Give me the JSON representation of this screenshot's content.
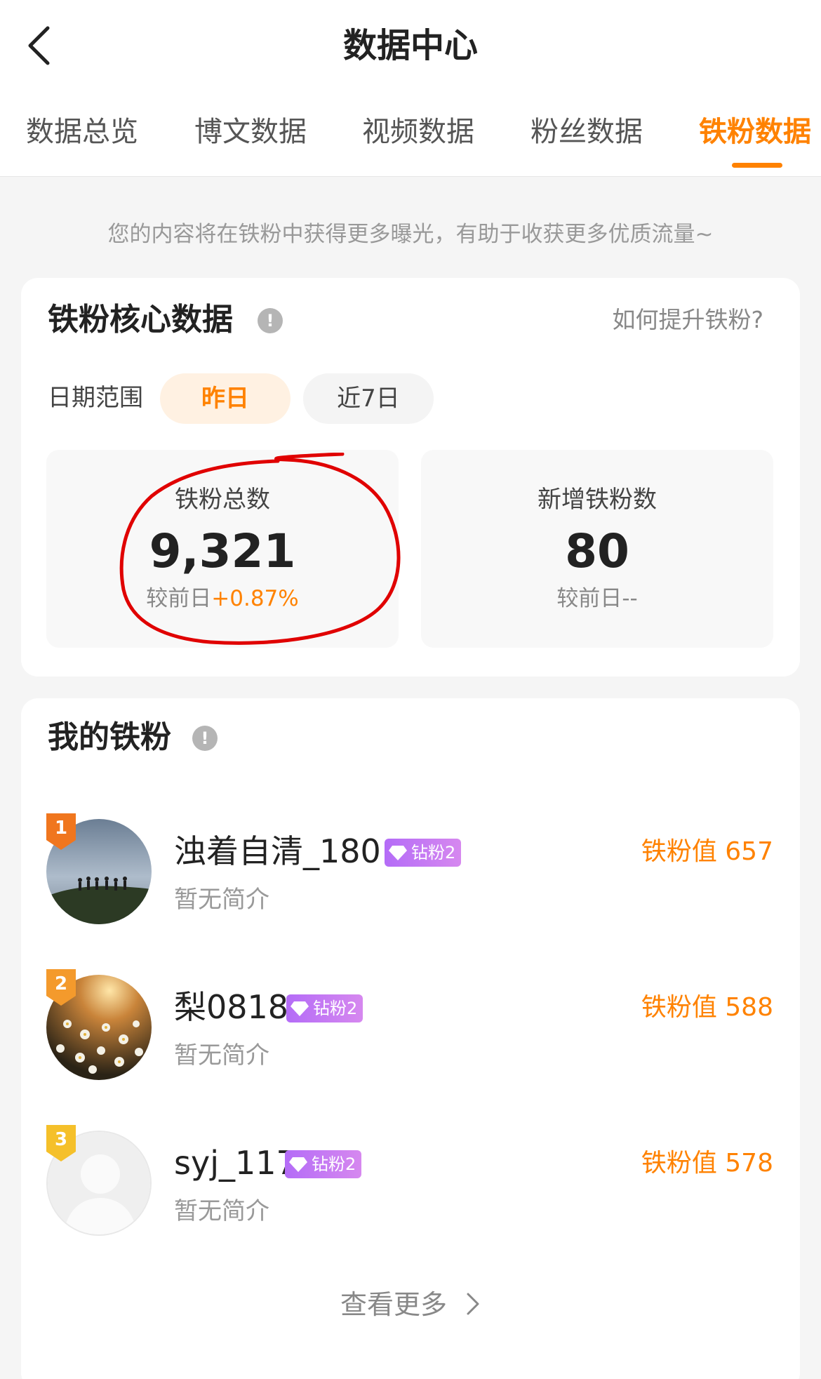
{
  "header": {
    "title": "数据中心",
    "back_icon": "chevron-left-icon"
  },
  "tabs": [
    {
      "label": "数据总览",
      "active": false
    },
    {
      "label": "博文数据",
      "active": false
    },
    {
      "label": "视频数据",
      "active": false
    },
    {
      "label": "粉丝数据",
      "active": false
    },
    {
      "label": "铁粉数据",
      "active": true
    }
  ],
  "tagline": "您的内容将在铁粉中获得更多曝光，有助于收获更多优质流量~",
  "core": {
    "title": "铁粉核心数据",
    "help_link": "如何提升铁粉?",
    "date_range_label": "日期范围",
    "ranges": [
      "昨日",
      "近7日"
    ],
    "selected_range": "昨日",
    "stats": [
      {
        "label": "铁粉总数",
        "value": "9,321",
        "compare_prefix": "较前日",
        "compare_value": "+0.87%"
      },
      {
        "label": "新增铁粉数",
        "value": "80",
        "compare_prefix": "较前日",
        "compare_value": "--"
      }
    ]
  },
  "fans": {
    "title": "我的铁粉",
    "items": [
      {
        "rank": "1",
        "name": "浊着自清_180",
        "badge": "钻粉2",
        "bio": "暂无简介",
        "score": "铁粉值 657"
      },
      {
        "rank": "2",
        "name": "梨0818",
        "badge": "钻粉2",
        "bio": "暂无简介",
        "score": "铁粉值 588"
      },
      {
        "rank": "3",
        "name": "syj_117",
        "badge": "钻粉2",
        "bio": "暂无简介",
        "score": "铁粉值 578"
      }
    ],
    "more_label": "查看更多"
  },
  "colors": {
    "accent": "#ff8200",
    "badge_purple": "#b46cf7",
    "annotation_red": "#e00000",
    "rank_1": "#f0761e",
    "rank_2": "#f49a2c",
    "rank_3": "#f5c02a"
  }
}
